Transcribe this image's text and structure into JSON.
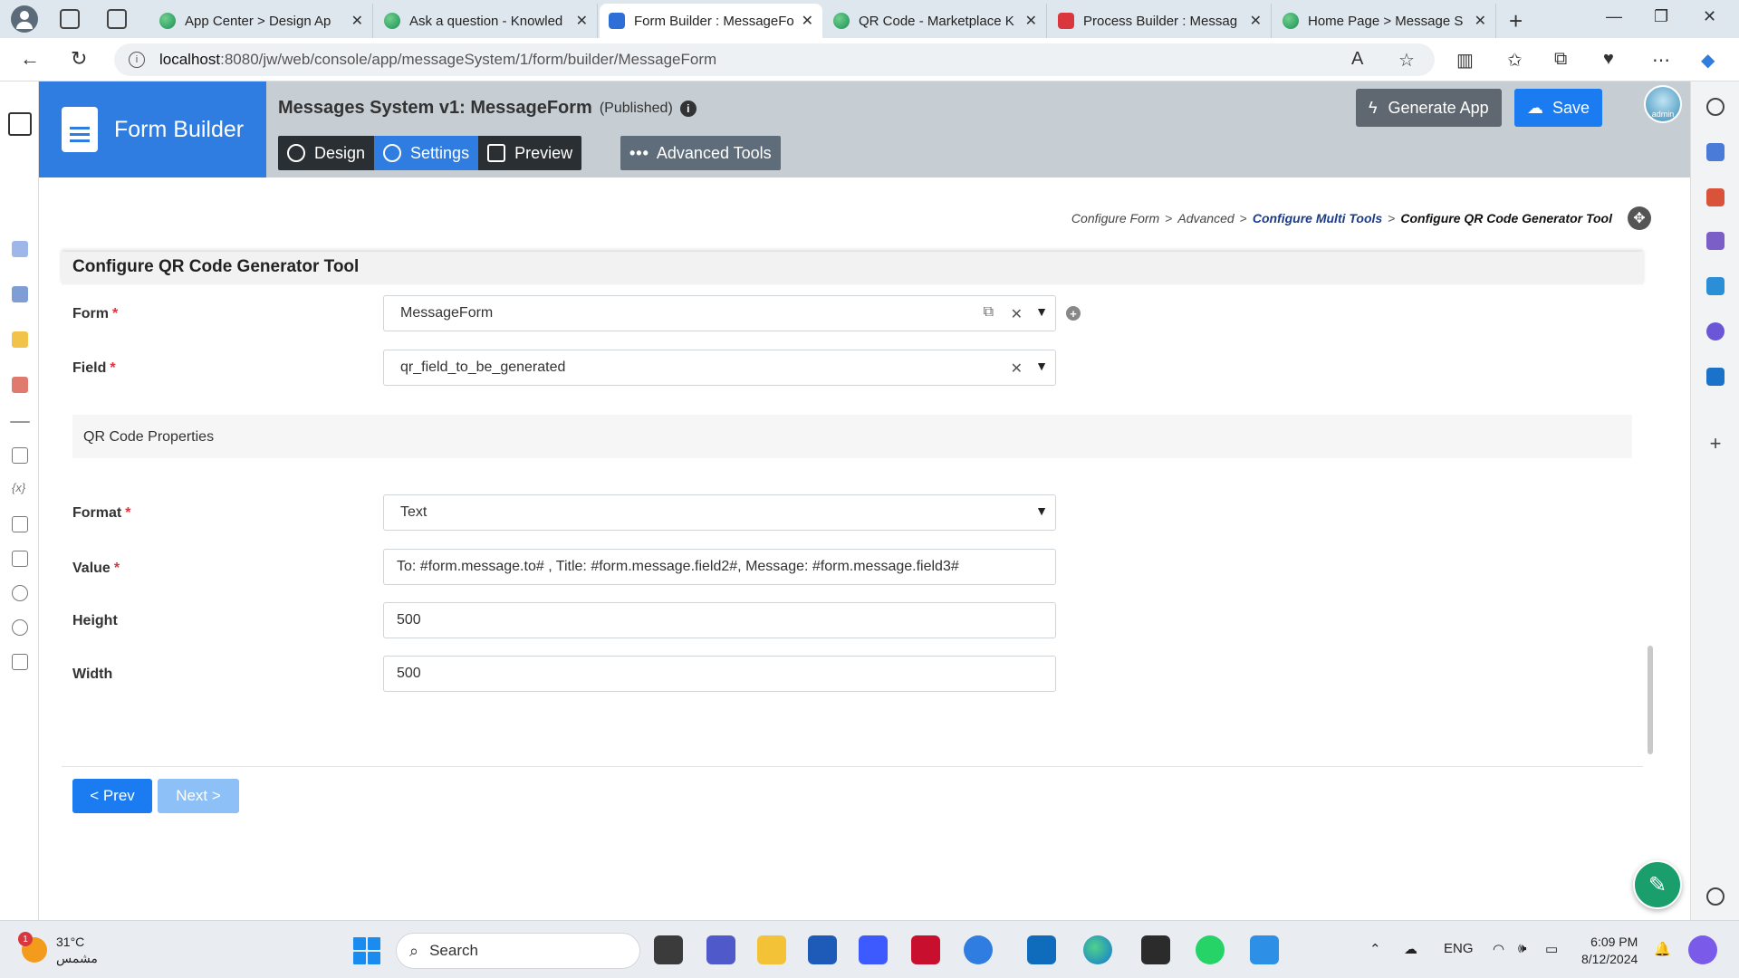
{
  "browser": {
    "tabs": [
      {
        "title": "App Center > Design Ap",
        "favicon": "edge-icon"
      },
      {
        "title": "Ask a question - Knowled",
        "favicon": "edge-icon"
      },
      {
        "title": "Form Builder : MessageFo",
        "favicon": "form-builder-icon",
        "active": true
      },
      {
        "title": "QR Code - Marketplace K",
        "favicon": "edge-icon"
      },
      {
        "title": "Process Builder : Messag",
        "favicon": "process-icon"
      },
      {
        "title": "Home Page > Message S",
        "favicon": "edge-icon"
      }
    ],
    "url_host": "localhost",
    "url_path": ":8080/jw/web/console/app/messageSystem/1/form/builder/MessageForm"
  },
  "header": {
    "brand": "Form Builder",
    "app_title": "Messages System v1: MessageForm",
    "status": "(Published)",
    "modes": [
      {
        "label": "Design",
        "icon": "design-icon"
      },
      {
        "label": "Settings",
        "icon": "gear-icon",
        "active": true
      },
      {
        "label": "Preview",
        "icon": "preview-icon"
      }
    ],
    "advanced_tools": "Advanced Tools",
    "generate_app": "Generate App",
    "save": "Save",
    "avatar_label": "admin"
  },
  "breadcrumb": {
    "items": [
      "Configure Form",
      "Advanced",
      "Configure Multi Tools",
      "Configure QR Code Generator Tool"
    ],
    "separator": ">"
  },
  "form": {
    "title": "Configure QR Code Generator Tool",
    "fields": {
      "form": {
        "label": "Form",
        "value": "MessageForm"
      },
      "field": {
        "label": "Field",
        "value": "qr_field_to_be_generated"
      },
      "section": "QR Code Properties",
      "format": {
        "label": "Format",
        "value": "Text"
      },
      "value": {
        "label": "Value",
        "value": "To: #form.message.to# , Title: #form.message.field2#,  Message: #form.message.field3#"
      },
      "height": {
        "label": "Height",
        "value": "500"
      },
      "width": {
        "label": "Width",
        "value": "500"
      }
    },
    "required_marker": "*",
    "prev": "< Prev",
    "next": "Next >"
  },
  "taskbar": {
    "weather_temp": "31°C",
    "weather_desc": "مشمس",
    "weather_badge": "1",
    "search": "Search",
    "lang": "ENG",
    "time": "6:09 PM",
    "date": "8/12/2024"
  },
  "colors": {
    "brand_blue": "#2f7de1",
    "save_blue": "#1a7cf0",
    "required_red": "#d9363e",
    "header_gray": "#c6cdd3"
  }
}
